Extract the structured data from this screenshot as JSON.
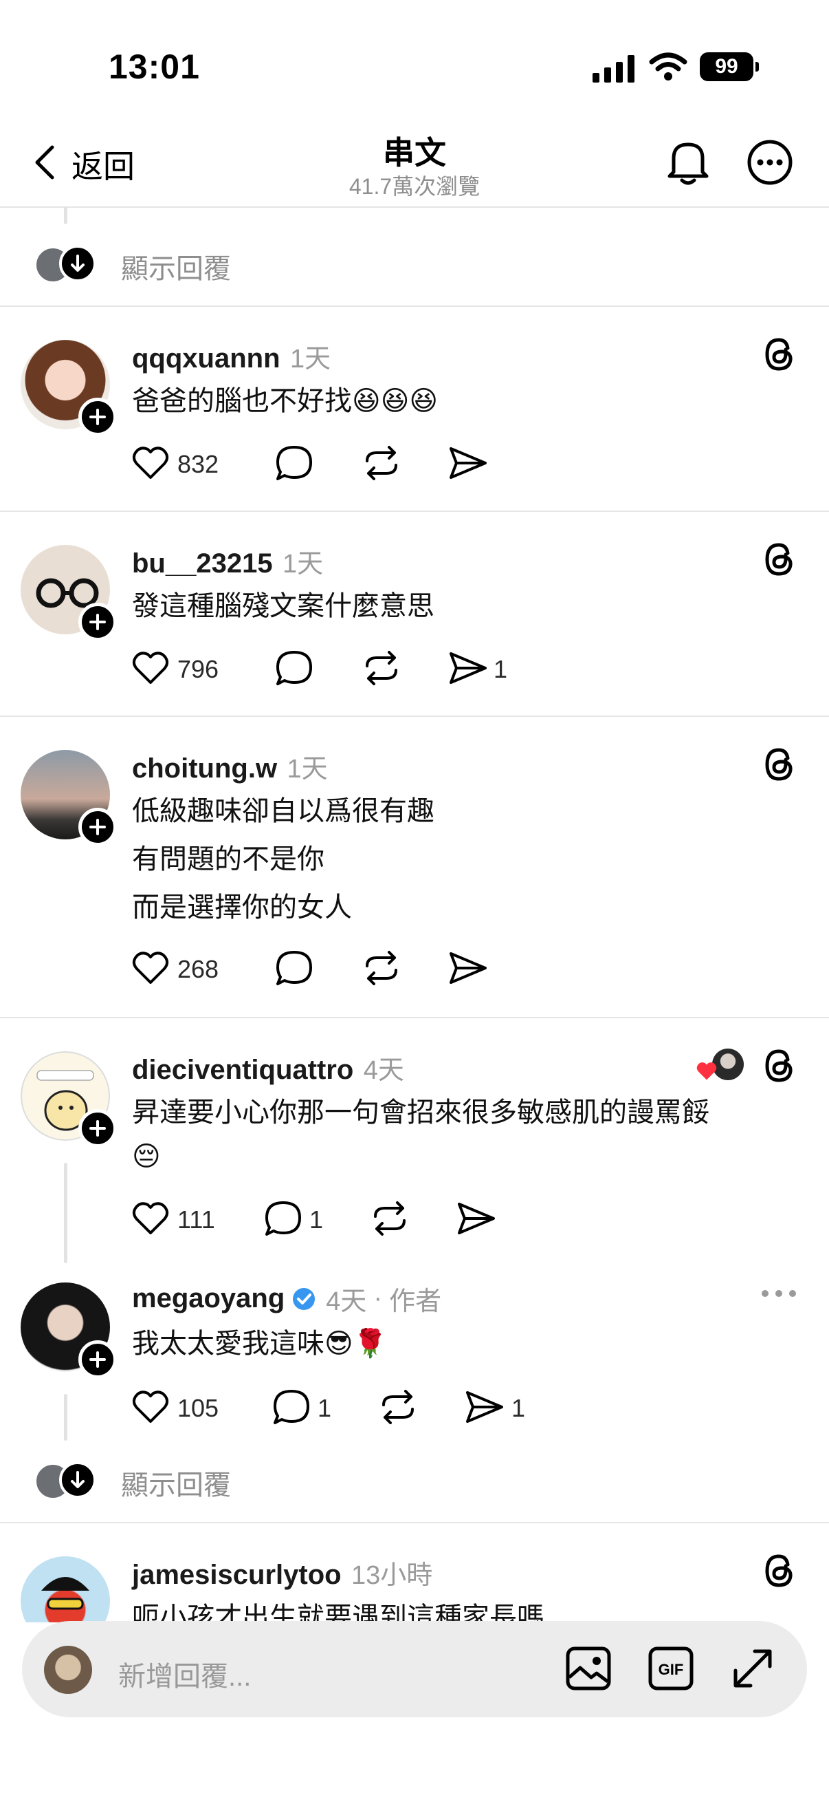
{
  "status_bar": {
    "time": "13:01",
    "battery": "99"
  },
  "header": {
    "back_label": "返回",
    "title": "串文",
    "subtitle": "41.7萬次瀏覽"
  },
  "show_replies_label": "顯示回覆",
  "posts": [
    {
      "username": "qqqxuannn",
      "time": "1天",
      "lines": [
        "爸爸的腦也不好找😆😆😆"
      ],
      "likes": "832",
      "replies": "",
      "shares": ""
    },
    {
      "username": "bu__23215",
      "time": "1天",
      "lines": [
        "發這種腦殘文案什麼意思"
      ],
      "likes": "796",
      "replies": "",
      "shares": "1"
    },
    {
      "username": "choitung.w",
      "time": "1天",
      "lines": [
        "低級趣味卻自以爲很有趣",
        "有問題的不是你",
        "而是選擇你的女人"
      ],
      "likes": "268",
      "replies": "",
      "shares": ""
    },
    {
      "username": "dieciventiquattro",
      "time": "4天",
      "lines": [
        "昇達要小心你那一句會招來很多敏感肌的謾罵餒",
        "😔"
      ],
      "likes": "111",
      "replies": "1",
      "shares": ""
    },
    {
      "username": "megaoyang",
      "time": "4天",
      "author_tag": "作者",
      "lines": [
        "我太太愛我這味😎🌹"
      ],
      "likes": "105",
      "replies": "1",
      "shares": "1"
    },
    {
      "username": "jamesiscurlytoo",
      "time": "13小時",
      "lines": [
        "呃小孩才出生就要遇到這種家長嗎"
      ]
    }
  ],
  "reply_input": {
    "placeholder": "新增回覆..."
  },
  "icons": {
    "back": "chevron-left-icon",
    "bell": "bell-icon",
    "more": "more-circle-icon",
    "threads": "threads-logo-icon",
    "like": "heart-icon",
    "reply": "comment-icon",
    "repost": "repost-icon",
    "share": "send-icon",
    "verified": "verified-badge-icon",
    "image": "image-icon",
    "gif": "gif-icon",
    "expand": "expand-icon"
  },
  "colors": {
    "verified": "#3797f0",
    "like_heart": "#ff3040",
    "secondary_text": "#8e8e8e"
  }
}
